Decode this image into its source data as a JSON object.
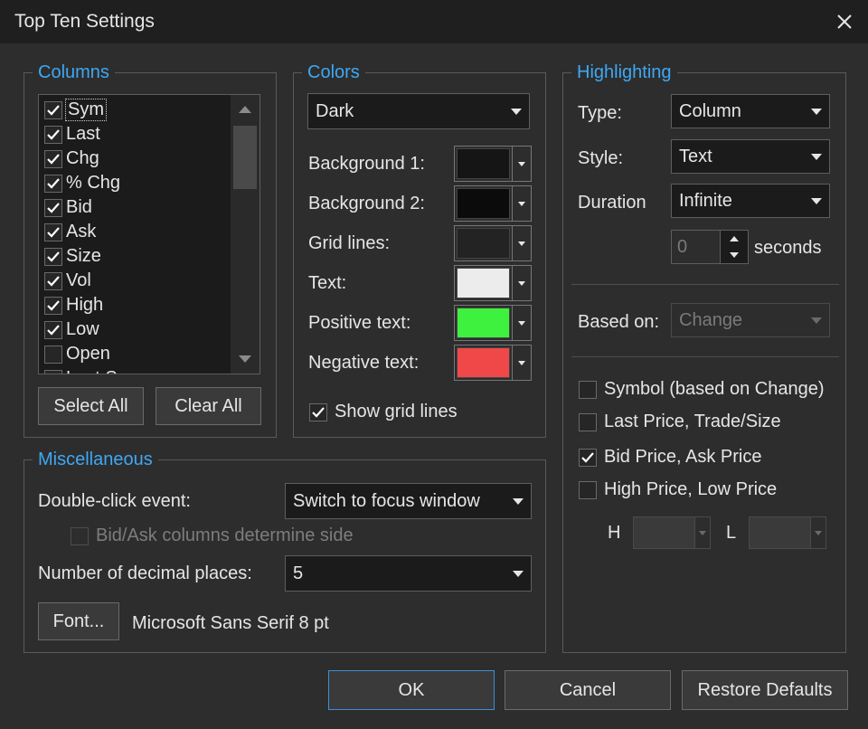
{
  "window": {
    "title": "Top Ten Settings"
  },
  "columns": {
    "legend": "Columns",
    "items": [
      {
        "label": "Sym",
        "checked": true
      },
      {
        "label": "Last",
        "checked": true
      },
      {
        "label": "Chg",
        "checked": true
      },
      {
        "label": "% Chg",
        "checked": true
      },
      {
        "label": "Bid",
        "checked": true
      },
      {
        "label": "Ask",
        "checked": true
      },
      {
        "label": "Size",
        "checked": true
      },
      {
        "label": "Vol",
        "checked": true
      },
      {
        "label": "High",
        "checked": true
      },
      {
        "label": "Low",
        "checked": true
      },
      {
        "label": "Open",
        "checked": false
      },
      {
        "label": "Last S",
        "checked": false
      }
    ],
    "select_all": "Select All",
    "clear_all": "Clear All"
  },
  "colors": {
    "legend": "Colors",
    "scheme": "Dark",
    "rows": [
      {
        "label": "Background 1:",
        "color": "#151515"
      },
      {
        "label": "Background 2:",
        "color": "#0b0b0b"
      },
      {
        "label": "Grid lines:",
        "color": "#232323"
      },
      {
        "label": "Text:",
        "color": "#ececec"
      },
      {
        "label": "Positive text:",
        "color": "#3ef13e"
      },
      {
        "label": "Negative text:",
        "color": "#f04848"
      }
    ],
    "show_grid_lines": "Show grid lines"
  },
  "highlighting": {
    "legend": "Highlighting",
    "type_label": "Type:",
    "type_value": "Column",
    "style_label": "Style:",
    "style_value": "Text",
    "duration_label": "Duration",
    "duration_value": "Infinite",
    "seconds_value": "0",
    "seconds_label": "seconds",
    "based_on_label": "Based on:",
    "based_on_value": "Change",
    "options": [
      {
        "label": "Symbol (based on Change)",
        "checked": false
      },
      {
        "label": "Last Price, Trade/Size",
        "checked": false
      },
      {
        "label": "Bid Price, Ask Price",
        "checked": true
      },
      {
        "label": "High Price, Low Price",
        "checked": false
      }
    ],
    "h_label": "H",
    "l_label": "L"
  },
  "misc": {
    "legend": "Miscellaneous",
    "double_click_label": "Double-click event:",
    "double_click_value": "Switch to focus window",
    "bid_ask_label": "Bid/Ask columns determine side",
    "decimal_label": "Number of decimal places:",
    "decimal_value": "5",
    "font_button": "Font...",
    "font_value": "Microsoft Sans Serif 8 pt"
  },
  "footer": {
    "ok": "OK",
    "cancel": "Cancel",
    "restore": "Restore Defaults"
  }
}
